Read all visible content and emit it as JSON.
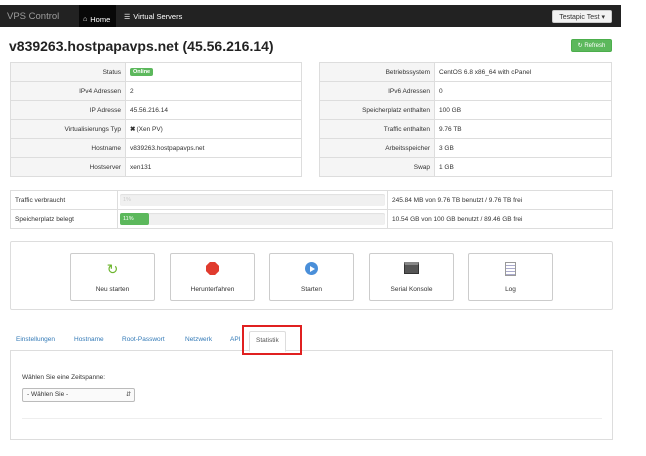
{
  "navbar": {
    "brand": "VPS Control",
    "home_label": "Home",
    "virtual_servers_label": "Virtual Servers",
    "user_label": "Testapic Test ▾"
  },
  "title": "v839263.hostpapavps.net (45.56.216.14)",
  "refresh_label": "↻ Refresh",
  "info_left": [
    {
      "label": "Status",
      "value": "Online"
    },
    {
      "label": "IPv4 Adressen",
      "value": "2"
    },
    {
      "label": "IP Adresse",
      "value": "45.56.216.14"
    },
    {
      "label": "Virtualisierungs Typ",
      "value": "(Xen PV)"
    },
    {
      "label": "Hostname",
      "value": "v839263.hostpapavps.net"
    },
    {
      "label": "Hostserver",
      "value": "xen131"
    }
  ],
  "info_right": [
    {
      "label": "Betriebssystem",
      "value": "CentOS 6.8 x86_64 with cPanel"
    },
    {
      "label": "IPv6 Adressen",
      "value": "0"
    },
    {
      "label": "Speicherplatz enthalten",
      "value": "100 GB"
    },
    {
      "label": "Traffic enthalten",
      "value": "9.76 TB"
    },
    {
      "label": "Arbeitsspeicher",
      "value": "3 GB"
    },
    {
      "label": "Swap",
      "value": "1 GB"
    }
  ],
  "usage": [
    {
      "label": "Traffic verbraucht",
      "percent_text": "1%",
      "fraction": 0.0,
      "detail": "245.84 MB von 9.76 TB benutzt / 9.76 TB frei"
    },
    {
      "label": "Speicherplatz belegt",
      "percent_text": "11%",
      "fraction": 0.11,
      "detail": "10.54 GB von 100 GB benutzt / 89.46 GB frei"
    }
  ],
  "actions": [
    {
      "label": "Neu starten",
      "icon": "refresh-icon"
    },
    {
      "label": "Herunterfahren",
      "icon": "stop-icon"
    },
    {
      "label": "Starten",
      "icon": "play-icon"
    },
    {
      "label": "Serial Konsole",
      "icon": "console-icon"
    },
    {
      "label": "Log",
      "icon": "log-icon"
    }
  ],
  "tabs": [
    "Einstellungen",
    "Hostname",
    "Root-Passwort",
    "Netzwerk",
    "API",
    "Statistik"
  ],
  "active_tab": "Statistik",
  "stats": {
    "choose_label": "Wählen Sie eine Zeitspanne:",
    "select_value": "- Wählen Sie -"
  },
  "colors": {
    "success": "#5cb85c",
    "link": "#337ab7",
    "highlight": "#e02020",
    "navbar": "#222222"
  }
}
